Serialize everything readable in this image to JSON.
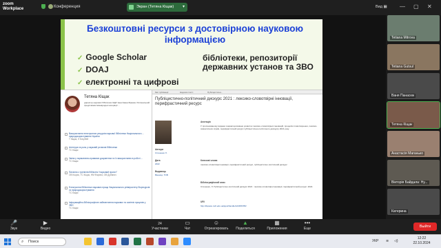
{
  "app": {
    "logo_line1": "zoom",
    "logo_line2": "Workplace",
    "conference": "Конференция",
    "share_banner": "Экран (Тетяна Кіщак)",
    "view_label": "Вид"
  },
  "slide": {
    "title": "Безкоштовні ресурси з достовірною науковою інформацією",
    "bullets": [
      "Google Scholar",
      "DOAJ",
      "електронні та цифрові"
    ],
    "right_text": "бібліотеки, репозиторії державних установ та ЗВО",
    "profile": {
      "name": "Тетяна Кіщак",
      "desc": "директор наукової бібліотеки ЖДУ імені Івана Франка. Регіональний представник міжнародної асоціації ...",
      "items": [
        {
          "title": "Використання електронних ресурсів наукової бібліотеки Національного ... природокористування України",
          "meta": "Т Кіщак, Л Кочубей"
        },
        {
          "title": "Агентура та роль у науковій установі бібліотеки",
          "meta": "ТС Кіщак"
        },
        {
          "title": "Зміни у нормативно-правових документах та їх використання в роботі ...",
          "meta": "ТС Кіщак"
        },
        {
          "title": "Питання з тренінгів бібліотек \"науковий проект\"",
          "meta": "ОВ Коцюк, ТС Кіщак, НМ Фарина, ОВ Дубанич"
        },
        {
          "title": "Електронна бібліотека наукових праць Національного університету біоресурсів та природокористування",
          "meta": "ТС Кіщак"
        },
        {
          "title": "Інформаційно-бібліографічне забезпечення наукових та освітніх процесів у ЗВО",
          "meta": "ТС Кіщак"
        }
      ]
    },
    "record": {
      "tabs": [
        "Мої публікації",
        "Наукові статті",
        "Публіцистичні..."
      ],
      "title": "Публіцистично-політичний дискурс 2021 : лексико-словотвірні інновації, перифрастичний ресурс",
      "abstract_label": "Анотація",
      "abstract": "У пропонованому виданні охарактеризовано розвиток лексико-словотвірних інновацій, процесів словотворення, лексико-семантичних зсувів, перифрастичний ресурс публіцистично-політичного дискурсу 2021 року.",
      "author_label": "Автори",
      "author": "Стишенко Л.",
      "date_label": "Дата",
      "date": "2022",
      "publisher_label": "Видавець",
      "publisher": "Вінниця, ТОВ",
      "keywords_label": "Ключові слова",
      "keywords": "лексико-словотвірні інновації, перифрастичний ресурс, публіцистично-політичний дискурс",
      "citation_label": "Бібліографічний опис",
      "citation": "Стишенко, Л. Публіцистично-політичний дискурс 2021 : лексико-словотвірні інновації, перифрастичний ресурс. 2022.",
      "uri_label": "URI",
      "uri": "http://dspace.nuft.edu.ua/jspui/handle/123456789/"
    }
  },
  "participants": [
    {
      "name": "Tetiana Mitrova",
      "color": "#6b7d6f"
    },
    {
      "name": "Tetiana Gutsul",
      "color": "#8a7660"
    },
    {
      "name": "Ваня Панасюк",
      "color": "#4a4a4a"
    },
    {
      "name": "Тетяна Кіщак",
      "color": "#7a5a4a"
    },
    {
      "name": "Анастасія Маганько",
      "color": "#9a8070"
    },
    {
      "name": "Вікторія Байдала: Ну...",
      "color": "#5e5a52"
    },
    {
      "name": "Катерина",
      "color": "#4a4a4a"
    }
  ],
  "toolbar": {
    "sound": "Звук",
    "video": "Видео",
    "participants": "Участники",
    "participants_count": "24",
    "chat": "Чат",
    "record": "Отреагировать",
    "share": "Поделиться",
    "apps": "Приложения",
    "more": "Еще",
    "end": "Выйти"
  },
  "taskbar": {
    "search_label": "Поиск",
    "lang": "УКР",
    "time": "12:22",
    "date": "22.10.2024"
  }
}
